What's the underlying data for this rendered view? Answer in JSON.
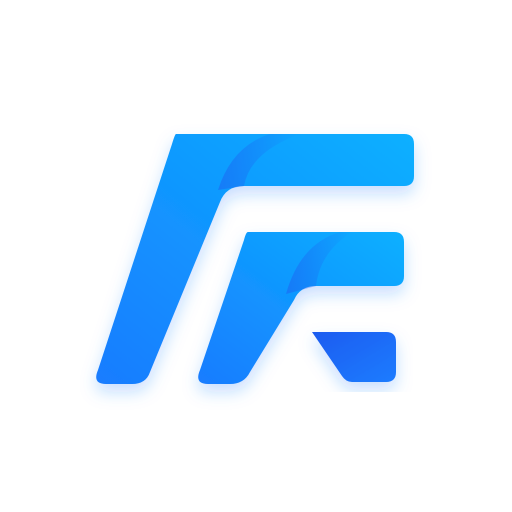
{
  "logo": {
    "icon": "stylized-letter-logo-icon",
    "colors": {
      "gradient_dark": "#1f5cf0",
      "gradient_mid": "#1a7cff",
      "gradient_light": "#08b0ff",
      "shadow": "#1a7cff",
      "background": "#ffffff"
    }
  }
}
